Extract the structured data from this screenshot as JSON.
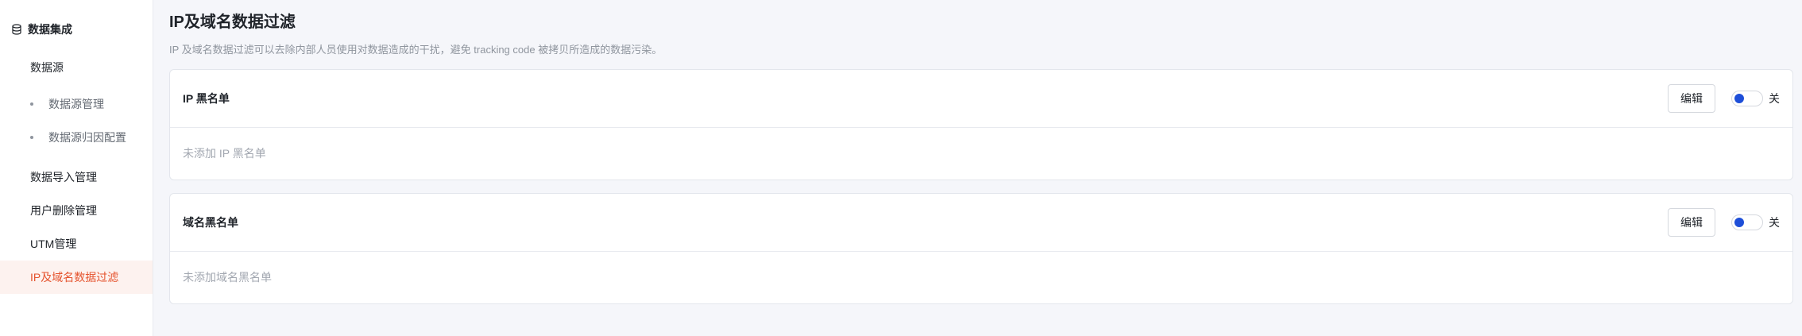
{
  "sidebar": {
    "section_title": "数据集成",
    "items": [
      {
        "label": "数据源",
        "type": "item"
      },
      {
        "label": "数据源管理",
        "type": "sub"
      },
      {
        "label": "数据源归因配置",
        "type": "sub"
      },
      {
        "label": "数据导入管理",
        "type": "item"
      },
      {
        "label": "用户删除管理",
        "type": "item"
      },
      {
        "label": "UTM管理",
        "type": "item"
      },
      {
        "label": "IP及域名数据过滤",
        "type": "item",
        "active": true
      }
    ]
  },
  "page": {
    "title": "IP及域名数据过滤",
    "description": "IP 及域名数据过滤可以去除内部人员使用对数据造成的干扰，避免 tracking code 被拷贝所造成的数据污染。"
  },
  "cards": [
    {
      "title": "IP 黑名单",
      "edit_label": "编辑",
      "toggle_label": "关",
      "toggle_on": false,
      "empty_text": "未添加 IP 黑名单"
    },
    {
      "title": "域名黑名单",
      "edit_label": "编辑",
      "toggle_label": "关",
      "toggle_on": false,
      "empty_text": "未添加域名黑名单"
    }
  ],
  "colors": {
    "accent": "#e5532d",
    "active_bg": "#fdf2ef",
    "toggle_knob": "#1d4ed8"
  }
}
